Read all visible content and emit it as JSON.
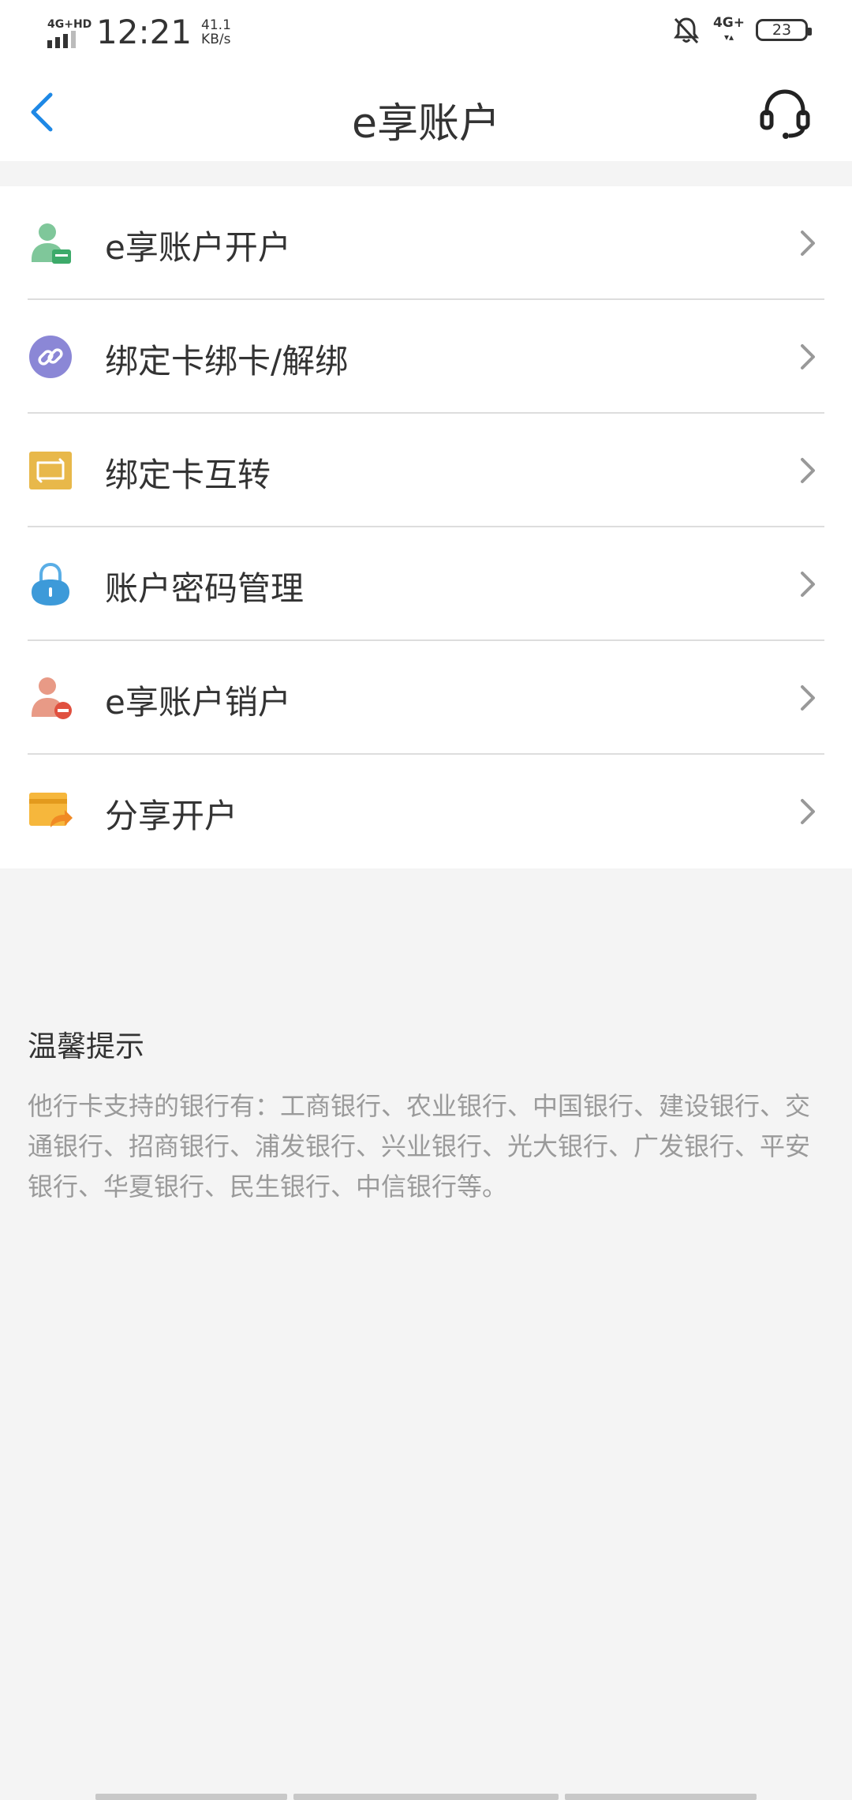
{
  "status_bar": {
    "network": "4G+HD",
    "time": "12:21",
    "speed_value": "41.1",
    "speed_unit": "KB/s",
    "network_right": "4G+",
    "battery": "23"
  },
  "header": {
    "title": "e享账户",
    "back_icon": "chevron-left-icon",
    "service_icon": "headset-icon"
  },
  "menu": {
    "items": [
      {
        "label": "e享账户开户",
        "icon": "user-card-icon"
      },
      {
        "label": "绑定卡绑卡/解绑",
        "icon": "link-icon"
      },
      {
        "label": "绑定卡互转",
        "icon": "transfer-card-icon"
      },
      {
        "label": "账户密码管理",
        "icon": "lock-icon"
      },
      {
        "label": "e享账户销户",
        "icon": "user-remove-icon"
      },
      {
        "label": "分享开户",
        "icon": "share-card-icon"
      }
    ]
  },
  "tips": {
    "title": "温馨提示",
    "body": "他行卡支持的银行有：工商银行、农业银行、中国银行、建设银行、交通银行、招商银行、浦发银行、兴业银行、光大银行、广发银行、平安银行、华夏银行、民生银行、中信银行等。"
  },
  "colors": {
    "accent": "#1e88e5",
    "background": "#f4f4f4",
    "tip_text": "#9a9a9a"
  }
}
